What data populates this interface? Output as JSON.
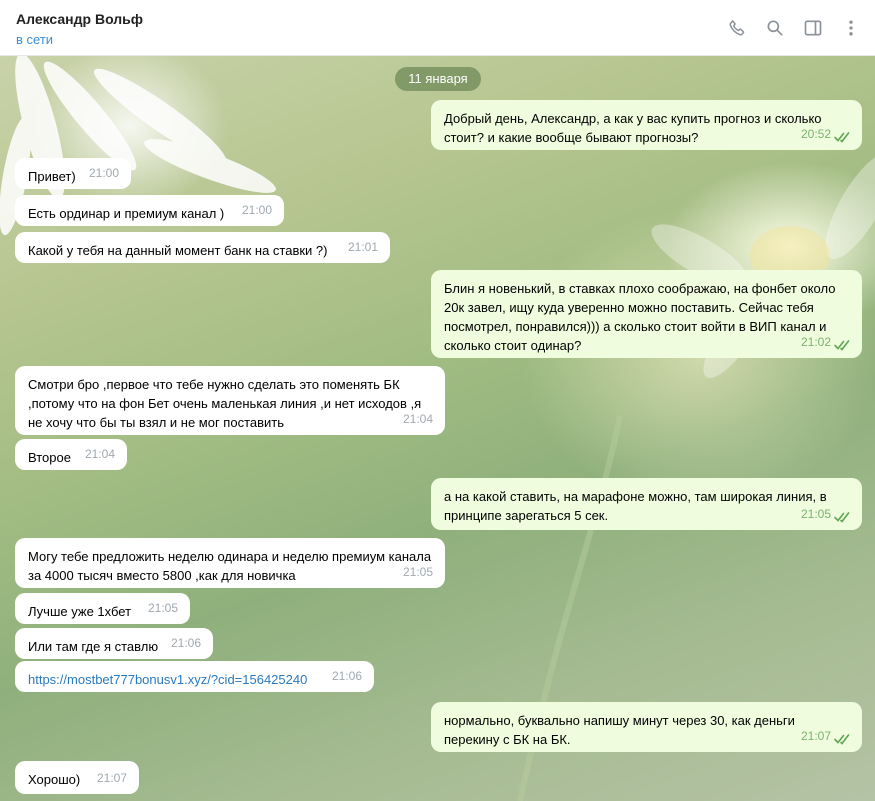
{
  "header": {
    "name": "Александр Вольф",
    "status": "в сети",
    "icons": [
      "phone-icon",
      "search-icon",
      "sidebar-toggle-icon",
      "more-vertical-icon"
    ]
  },
  "chat": {
    "date": "11 января",
    "messages": [
      {
        "dir": "out",
        "text": "Добрый день, Александр, а как у вас купить прогноз и сколько стоит? и какие вообще бывают прогнозы?",
        "time": "20:52"
      },
      {
        "dir": "in",
        "text": "Привет)",
        "time": "21:00"
      },
      {
        "dir": "in",
        "text": "Есть ординар и премиум канал )",
        "time": "21:00"
      },
      {
        "dir": "in",
        "text": "Какой у тебя на данный момент банк на ставки ?)",
        "time": "21:01"
      },
      {
        "dir": "out",
        "text": "Блин я новенький, в ставках плохо соображаю, на фонбет около 20к завел, ищу куда уверенно можно поставить. Сейчас тебя посмотрел, понравился))) а сколько стоит войти в ВИП канал и сколько стоит одинар?",
        "time": "21:02"
      },
      {
        "dir": "in",
        "text": "Смотри бро ,первое что тебе нужно сделать это поменять БК ,потому что на фон Бет очень маленькая линия ,и нет исходов ,я не хочу что бы ты взял и не мог поставить",
        "time": "21:04"
      },
      {
        "dir": "in",
        "text": "Второе",
        "time": "21:04"
      },
      {
        "dir": "out",
        "text": "а на какой ставить, на марафоне можно, там широкая линия, в принципе зарегаться 5 сек.",
        "time": "21:05"
      },
      {
        "dir": "in",
        "text": "Могу тебе предложить неделю одинара и неделю премиум канала за 4000 тысяч вместо 5800 ,как для новичка",
        "time": "21:05"
      },
      {
        "dir": "in",
        "text": "Лучше уже 1хбет",
        "time": "21:05"
      },
      {
        "dir": "in",
        "text": "Или там где я ставлю",
        "time": "21:06"
      },
      {
        "dir": "in",
        "text": "https://mostbet777bonusv1.xyz/?cid=156425240",
        "time": "21:06",
        "link": true
      },
      {
        "dir": "out",
        "text": "нормально, буквально напишу минут через 30, как деньги перекину с БК на БК.",
        "time": "21:07"
      },
      {
        "dir": "in",
        "text": "Хорошо)",
        "time": "21:07"
      }
    ]
  }
}
